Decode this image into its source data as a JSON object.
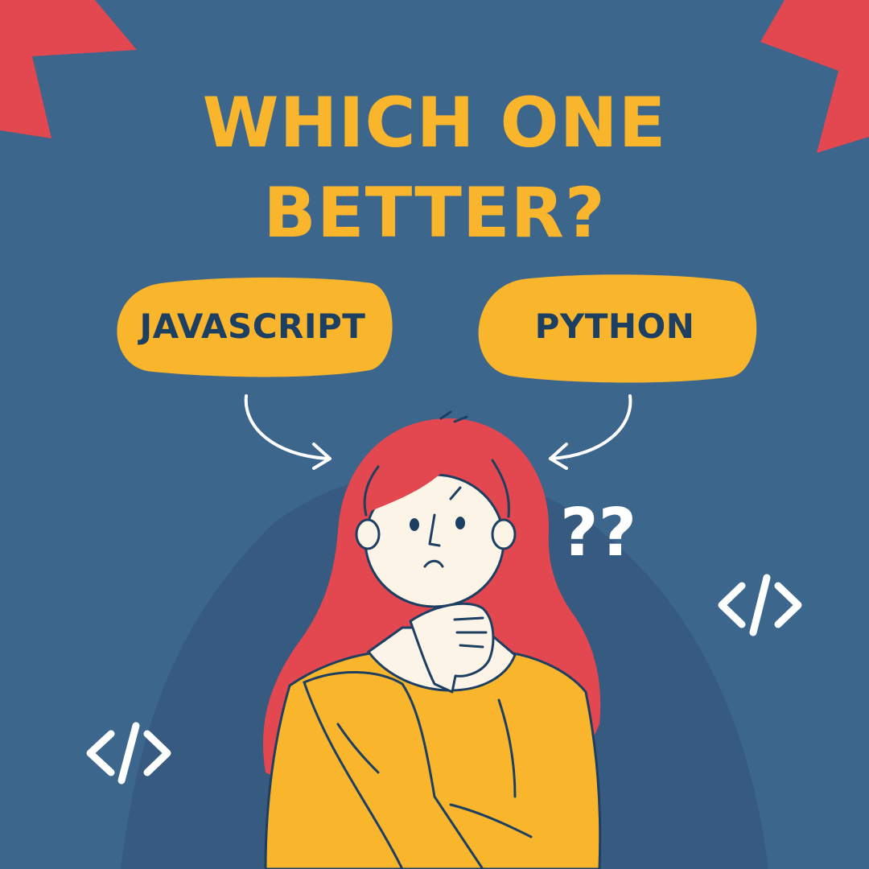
{
  "headline": {
    "line1": "WHICH ONE",
    "line2": "BETTER?"
  },
  "options": [
    {
      "label": "JAVASCRIPT"
    },
    {
      "label": "PYTHON"
    }
  ],
  "decorations": {
    "question_marks": "??",
    "code_icon": "code-brackets-icon"
  },
  "colors": {
    "background": "#3d668c",
    "accent_yellow": "#f9b62c",
    "accent_red": "#e3474f",
    "text_dark": "#1d3f61",
    "skin": "#fcf4e7",
    "white": "#ffffff"
  }
}
